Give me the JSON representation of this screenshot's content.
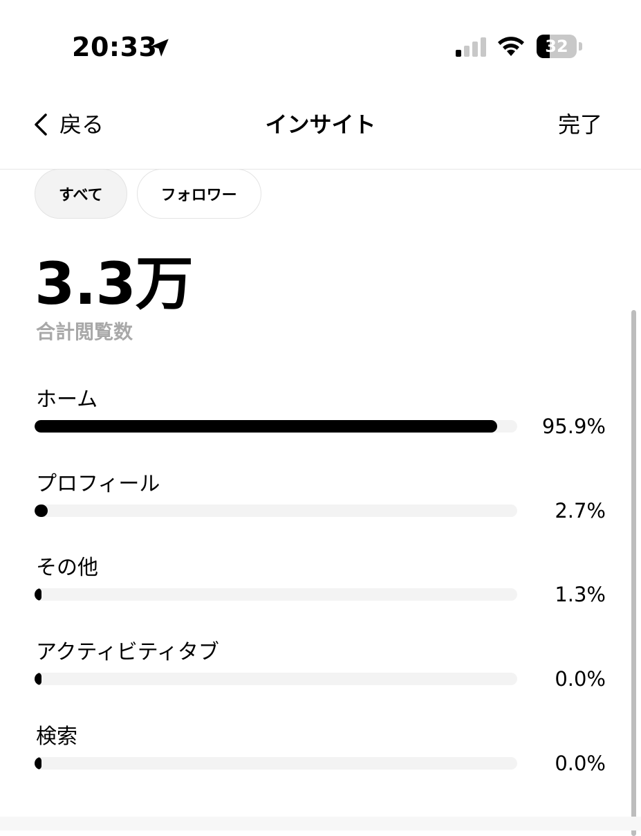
{
  "status_bar": {
    "time": "20:33",
    "battery": "32",
    "battery_percent": 32,
    "signal_bars_active": 1,
    "signal_bars_total": 4,
    "icons": [
      "location-arrow-icon",
      "cellular-signal-icon",
      "wifi-icon",
      "battery-icon"
    ]
  },
  "nav": {
    "back_label": "戻る",
    "title": "インサイト",
    "done_label": "完了"
  },
  "filters": [
    {
      "label": "すべて",
      "selected": true
    },
    {
      "label": "フォロワー",
      "selected": false
    }
  ],
  "total": {
    "value": "3.3万",
    "label": "合計閲覧数"
  },
  "breakdown": [
    {
      "label": "ホーム",
      "percent": "95.9%",
      "value": 95.9
    },
    {
      "label": "プロフィール",
      "percent": "2.7%",
      "value": 2.7
    },
    {
      "label": "その他",
      "percent": "1.3%",
      "value": 1.3
    },
    {
      "label": "アクティビティタブ",
      "percent": "0.0%",
      "value": 0.0
    },
    {
      "label": "検索",
      "percent": "0.0%",
      "value": 0.0
    }
  ],
  "colors": {
    "bar_fill": "#000000",
    "bar_track": "#f3f3f3",
    "secondary_text": "#a8a8a8",
    "chip_selected_bg": "#f3f3f3"
  }
}
